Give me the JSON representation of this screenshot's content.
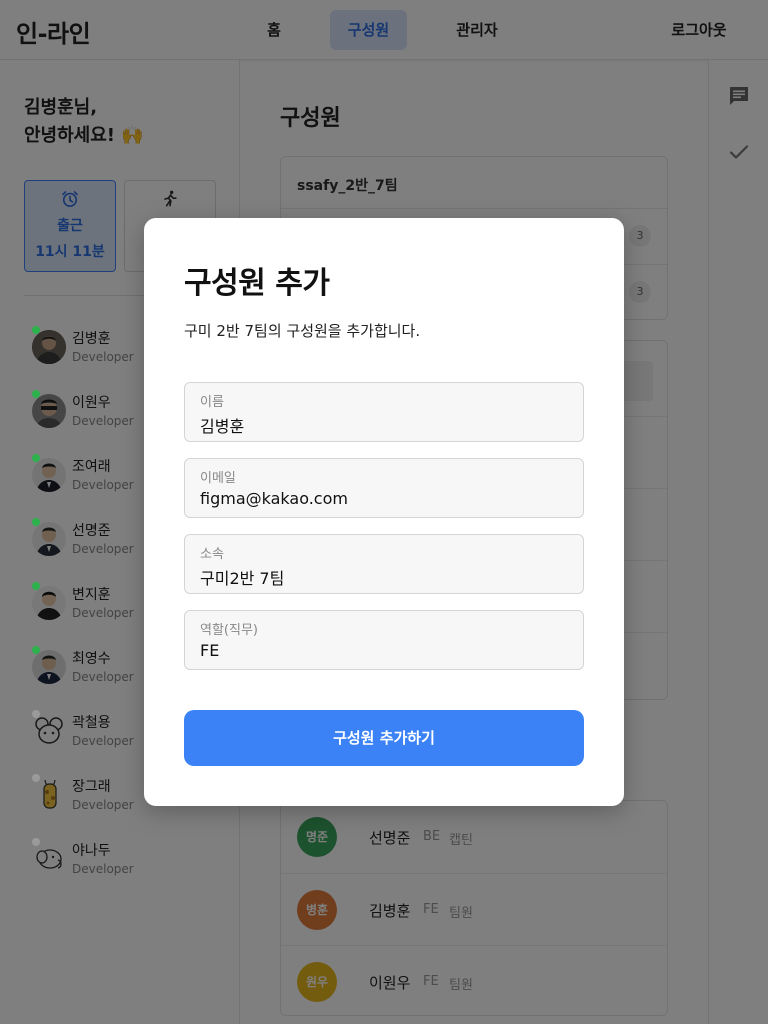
{
  "app": {
    "logo": "인-라인"
  },
  "nav": {
    "home": "홈",
    "members": "구성원",
    "admin": "관리자",
    "logout": "로그아웃"
  },
  "sidebar": {
    "greeting_line1": "김병훈님,",
    "greeting_line2": "안녕하세요! 🙌",
    "checkin": {
      "label": "출근",
      "time": "11시 11분",
      "icon": "alarm-clock-icon"
    },
    "second_card_icon": "running-person-icon",
    "members": [
      {
        "name": "김병훈",
        "role": "Developer",
        "online": true
      },
      {
        "name": "이원우",
        "role": "Developer",
        "online": true
      },
      {
        "name": "조여래",
        "role": "Developer",
        "online": true
      },
      {
        "name": "선명준",
        "role": "Developer",
        "online": true
      },
      {
        "name": "변지훈",
        "role": "Developer",
        "online": true
      },
      {
        "name": "최영수",
        "role": "Developer",
        "online": true
      },
      {
        "name": "곽철용",
        "role": "Developer",
        "online": false
      },
      {
        "name": "장그래",
        "role": "Developer",
        "online": false
      },
      {
        "name": "야나두",
        "role": "Developer",
        "online": false
      }
    ]
  },
  "main": {
    "title": "구성원",
    "team_name": "ssafy_2반_7팀",
    "team_rows": [
      {
        "count": "3"
      },
      {
        "count": "3"
      }
    ],
    "roster": [
      {
        "badge": "명준",
        "name": "선명준",
        "dept": "BE",
        "position": "캡틴",
        "color": "#3aa55d"
      },
      {
        "badge": "병훈",
        "name": "김병훈",
        "dept": "FE",
        "position": "팀원",
        "color": "#e07a3a"
      },
      {
        "badge": "원우",
        "name": "이원우",
        "dept": "FE",
        "position": "팀원",
        "color": "#e8b81f"
      }
    ]
  },
  "right_rail": {
    "icons": [
      "chat-icon",
      "check-icon"
    ]
  },
  "modal": {
    "title": "구성원 추가",
    "description": "구미 2반 7팀의 구성원을 추가합니다.",
    "fields": [
      {
        "label": "이름",
        "value": "김병훈"
      },
      {
        "label": "이메일",
        "value": "figma@kakao.com"
      },
      {
        "label": "소속",
        "value": "구미2반 7팀"
      },
      {
        "label": "역할(직무)",
        "value": "FE"
      }
    ],
    "submit_label": "구성원 추가하기"
  },
  "colors": {
    "accent": "#3b82f6",
    "nav_active_bg": "#d7e3fb",
    "online": "#2bb24c",
    "offline": "#9a9a9a"
  }
}
